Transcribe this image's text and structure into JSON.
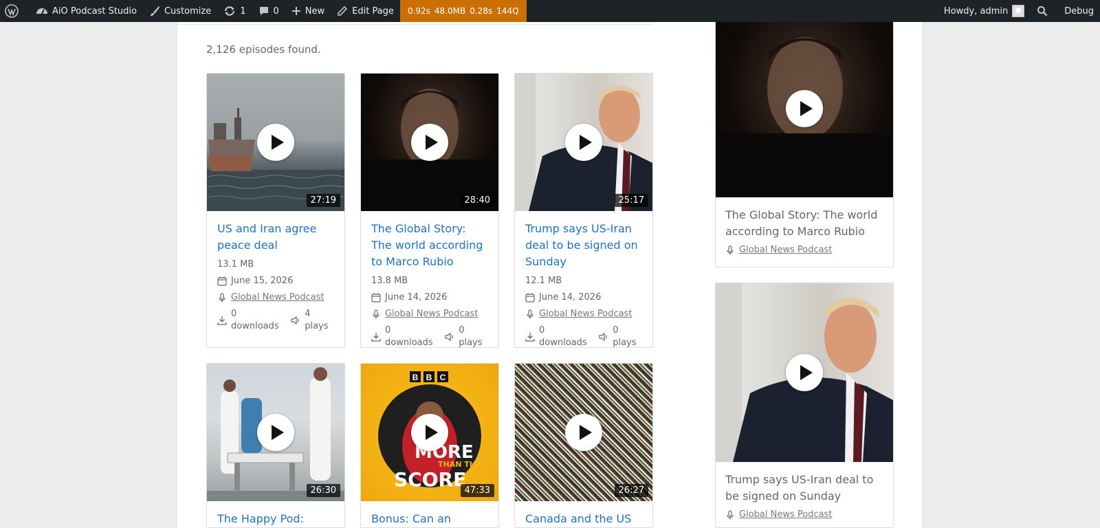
{
  "adminbar": {
    "site_name": "AiO Podcast Studio",
    "customize": "Customize",
    "updates_count": "1",
    "comments_count": "0",
    "new": "New",
    "edit_page": "Edit Page",
    "debug_time": "0.92s",
    "debug_mem": "48.0MB",
    "debug_query_time": "0.28s",
    "debug_queries": "144Q",
    "greeting": "Howdy, admin",
    "debug_label": "Debug"
  },
  "results": {
    "count_text": "2,126 episodes found."
  },
  "episodes": [
    {
      "title": "US and Iran agree peace deal",
      "duration": "27:19",
      "size": "13.1 MB",
      "date": "June 15, 2026",
      "podcast": "Global News Podcast",
      "downloads": "0 downloads",
      "plays": "4 plays"
    },
    {
      "title": "The Global Story: The world according to Marco Rubio",
      "duration": "28:40",
      "size": "13.8 MB",
      "date": "June 14, 2026",
      "podcast": "Global News Podcast",
      "downloads": "0 downloads",
      "plays": "0 plays"
    },
    {
      "title": "Trump says US-Iran deal to be signed on Sunday",
      "duration": "25:17",
      "size": "12.1 MB",
      "date": "June 14, 2026",
      "podcast": "Global News Podcast",
      "downloads": "0 downloads",
      "plays": "0 plays"
    },
    {
      "title": "The Happy Pod:",
      "duration": "26:30"
    },
    {
      "title": "Bonus: Can an African",
      "duration": "47:33"
    },
    {
      "title": "Canada and the US",
      "duration": "26:27"
    }
  ],
  "bbc_art": {
    "brand": "BBC",
    "line1": "MORE",
    "line2": "THAN THE",
    "line3": "SCORE"
  },
  "sidebar": [
    {
      "title": "The Global Story: The world according to Marco Rubio",
      "podcast": "Global News Podcast"
    },
    {
      "title": "Trump says US-Iran deal to be signed on Sunday",
      "podcast": "Global News Podcast"
    }
  ],
  "icons": {
    "wordpress": "wordpress-logo-icon",
    "dashboard": "dashboard-icon",
    "customize": "brush-icon",
    "updates": "refresh-icon",
    "comments": "comment-icon",
    "new": "plus-icon",
    "edit": "pencil-icon",
    "search": "search-icon",
    "calendar": "calendar-icon",
    "mic": "microphone-icon",
    "download": "download-icon",
    "speaker": "speaker-icon"
  },
  "colors": {
    "adminbar_bg": "#1d2327",
    "debug_bg": "#c96f04",
    "link": "#1e73be"
  }
}
